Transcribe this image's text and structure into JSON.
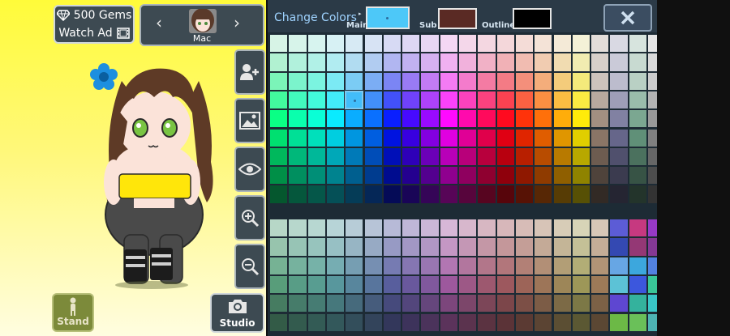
{
  "header": {
    "gems_label": "500 Gems",
    "watch_ad_label": "Watch Ad",
    "character_name": "Mac"
  },
  "bottom": {
    "stand_label": "Stand",
    "studio_label": "Studio"
  },
  "palette": {
    "title": "Change Colors",
    "main_label": "Main",
    "sub_label": "Sub",
    "outline_label": "Outline",
    "main_color": "#4dc8f8",
    "sub_color": "#5a2a24",
    "outline_color": "#000000",
    "close_icon": "close-icon"
  },
  "icons": {
    "gem": "diamond-icon",
    "watch_ad": "film-icon",
    "prev": "chevron-left-icon",
    "next": "chevron-right-icon",
    "add_character": "add-person-icon",
    "background": "image-icon",
    "eye": "eye-icon",
    "zoom_in": "zoom-in-icon",
    "zoom_out": "zoom-out-icon",
    "camera": "camera-icon"
  }
}
